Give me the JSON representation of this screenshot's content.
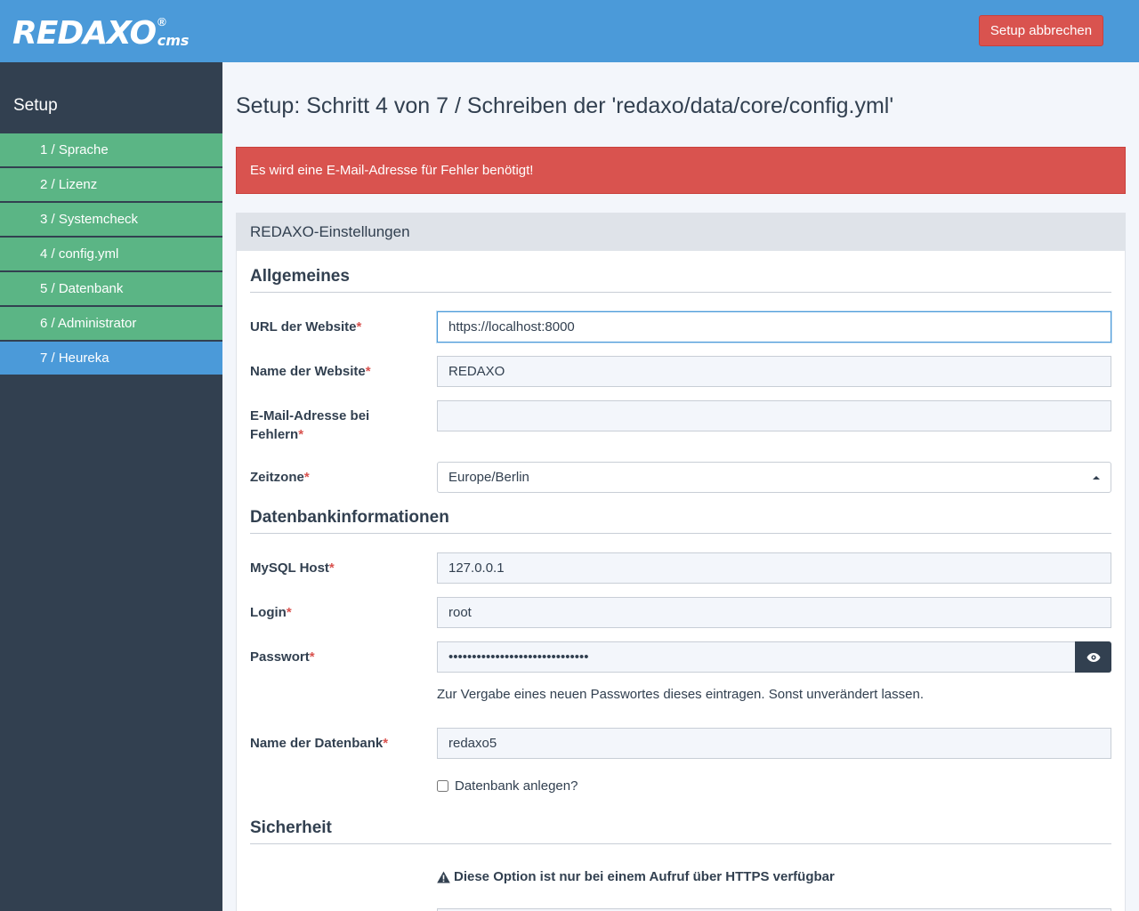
{
  "header": {
    "logo_text": "REDAXO",
    "logo_reg": "®",
    "logo_cms": "cms",
    "cancel_label": "Setup abbrechen"
  },
  "sidebar": {
    "title": "Setup",
    "steps": [
      {
        "label": "1 / Sprache"
      },
      {
        "label": "2 / Lizenz"
      },
      {
        "label": "3 / Systemcheck"
      },
      {
        "label": "4 / config.yml"
      },
      {
        "label": "5 / Datenbank"
      },
      {
        "label": "6 / Administrator"
      },
      {
        "label": "7 / Heureka",
        "active": true
      }
    ]
  },
  "main": {
    "title": "Setup: Schritt 4 von 7 / Schreiben der 'redaxo/data/core/config.yml'",
    "alert": "Es wird eine E-Mail-Adresse für Fehler benötigt!",
    "panel_heading": "REDAXO-Einstellungen",
    "required_marker": "*",
    "general": {
      "title": "Allgemeines",
      "url_label": "URL der Website",
      "url_value": "https://localhost:8000",
      "name_label": "Name der Website",
      "name_value": "REDAXO",
      "email_label_1": "E-Mail-Adresse bei",
      "email_label_2": "Fehlern",
      "email_value": "",
      "timezone_label": "Zeitzone",
      "timezone_value": "Europe/Berlin"
    },
    "database": {
      "title": "Datenbankinformationen",
      "host_label": "MySQL Host",
      "host_value": "127.0.0.1",
      "login_label": "Login",
      "login_value": "root",
      "password_label": "Passwort",
      "password_value": "••••••••••••••••••••••••••••••",
      "password_help": "Zur Vergabe eines neuen Passwortes dieses eintragen. Sonst unverändert lassen.",
      "dbname_label": "Name der Datenbank",
      "dbname_value": "redaxo5",
      "create_db_label": "Datenbank anlegen?"
    },
    "security": {
      "title": "Sicherheit",
      "https_warning": "Diese Option ist nur bei einem Aufruf über HTTPS verfügbar"
    }
  }
}
